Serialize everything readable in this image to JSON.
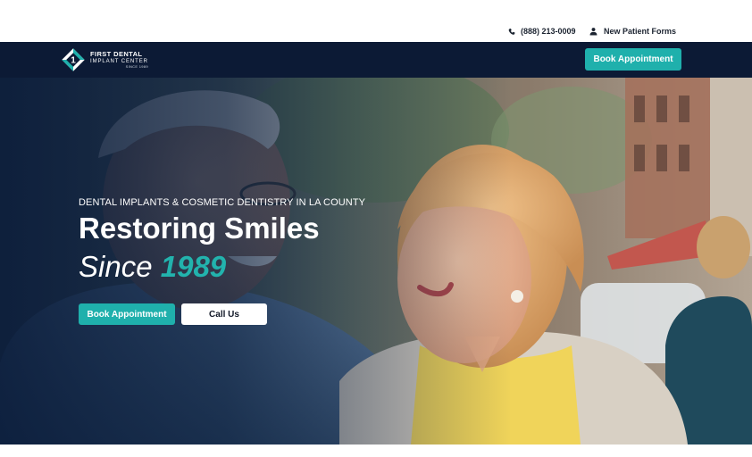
{
  "topbar": {
    "phone_icon": "phone-icon",
    "phone": "(888) 213-0009",
    "forms_icon": "user-icon",
    "forms_label": "New Patient Forms"
  },
  "navbar": {
    "logo": {
      "mark_number": "1",
      "line1": "FIRST DENTAL",
      "line2": "IMPLANT CENTER",
      "line3": "SINCE 1989"
    },
    "cta_label": "Book Appointment"
  },
  "hero": {
    "image": "senior-couple-smiling-photo",
    "eyebrow": "DENTAL IMPLANTS & COSMETIC DENTISTRY IN LA COUNTY",
    "title": "Restoring Smiles",
    "subtitle_prefix": "Since",
    "subtitle_year": "1989",
    "book_label": "Book Appointment",
    "call_label": "Call Us"
  },
  "colors": {
    "navy": "#0c1a35",
    "teal": "#1fb0ac",
    "white": "#ffffff"
  }
}
